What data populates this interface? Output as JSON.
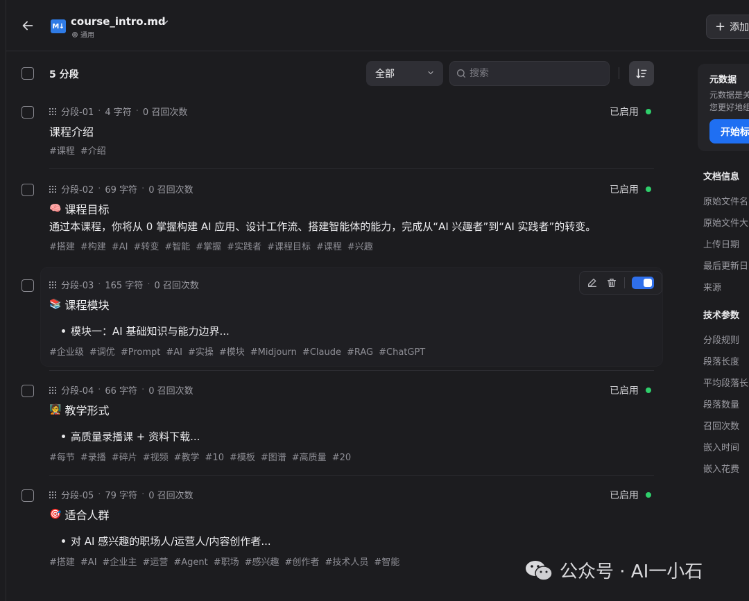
{
  "header": {
    "file_name": "course_intro.md",
    "file_badge": "M↓",
    "file_sub": "通用",
    "add_button": "添加"
  },
  "toolbar": {
    "segment_count": "5 分段",
    "filter_value": "全部",
    "search_placeholder": "搜索"
  },
  "segments": [
    {
      "id": "分段-01",
      "chars": "4 字符",
      "recalls": "0 召回次数",
      "title": "课程介绍",
      "emoji": "",
      "status": "已启用",
      "tags": [
        "#课程",
        "#介绍"
      ]
    },
    {
      "id": "分段-02",
      "chars": "69 字符",
      "recalls": "0 召回次数",
      "title": "课程目标",
      "emoji": "🧠",
      "body": "通过本课程，你将从 0 掌握构建 AI 应用、设计工作流、搭建智能体的能力，完成从“AI 兴趣者”到“AI 实践者”的转变。",
      "status": "已启用",
      "tags": [
        "#搭建",
        "#构建",
        "#AI",
        "#转变",
        "#智能",
        "#掌握",
        "#实践者",
        "#课程目标",
        "#课程",
        "#兴趣"
      ]
    },
    {
      "id": "分段-03",
      "chars": "165 字符",
      "recalls": "0 召回次数",
      "title": "课程模块",
      "emoji": "📚",
      "bullet": "模块一：AI 基础知识与能力边界...",
      "tags": [
        "#企业级",
        "#调优",
        "#Prompt",
        "#AI",
        "#实操",
        "#模块",
        "#Midjourn",
        "#Claude",
        "#RAG",
        "#ChatGPT"
      ]
    },
    {
      "id": "分段-04",
      "chars": "66 字符",
      "recalls": "0 召回次数",
      "title": "教学形式",
      "emoji": "🧑‍🏫",
      "bullet": "高质量录播课 + 资料下载...",
      "status": "已启用",
      "tags": [
        "#每节",
        "#录播",
        "#碎片",
        "#视频",
        "#教学",
        "#10",
        "#模板",
        "#图谱",
        "#高质量",
        "#20"
      ]
    },
    {
      "id": "分段-05",
      "chars": "79 字符",
      "recalls": "0 召回次数",
      "title": "适合人群",
      "emoji": "🎯",
      "bullet": "对 AI 感兴趣的职场人/运营人/内容创作者...",
      "status": "已启用",
      "tags": [
        "#搭建",
        "#AI",
        "#企业主",
        "#运营",
        "#Agent",
        "#职场",
        "#感兴趣",
        "#创作者",
        "#技术人员",
        "#智能"
      ]
    }
  ],
  "right_panel": {
    "metadata_title": "元数据",
    "metadata_desc_1": "元数据是关",
    "metadata_desc_2": "您更好地组",
    "metadata_button": "开始标",
    "doc_info_title": "文档信息",
    "doc_info_items": [
      "原始文件名",
      "原始文件大",
      "上传日期",
      "最后更新日",
      "来源"
    ],
    "tech_title": "技术参数",
    "tech_items": [
      "分段规则",
      "段落长度",
      "平均段落长",
      "段落数量",
      "召回次数",
      "嵌入时间",
      "嵌入花费"
    ]
  },
  "watermark": {
    "text": "公众号 · AI一小石"
  },
  "colors": {
    "background": "#1c1c1f",
    "accent": "#2f6fea",
    "enabled_dot": "#2fcf6b"
  }
}
